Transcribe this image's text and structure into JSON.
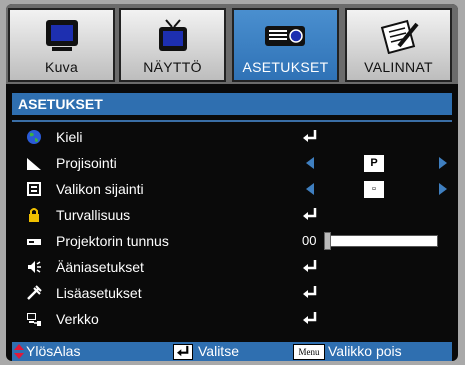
{
  "tabs": [
    {
      "label": "Kuva",
      "icon": "monitor-icon"
    },
    {
      "label": "NÄYTTÖ",
      "icon": "tv-icon"
    },
    {
      "label": "ASETUKSET",
      "icon": "projector-icon",
      "active": true
    },
    {
      "label": "VALINNAT",
      "icon": "notepad-pencil-icon"
    }
  ],
  "section_title": "ASETUKSET",
  "menu": {
    "items": [
      {
        "label": "Kieli",
        "icon": "globe-icon",
        "control": "enter"
      },
      {
        "label": "Projisointi",
        "icon": "projection-icon",
        "control": "selector",
        "value": "P"
      },
      {
        "label": "Valikon sijainti",
        "icon": "menu-location-icon",
        "control": "selector",
        "value": "▫"
      },
      {
        "label": "Turvallisuus",
        "icon": "lock-icon",
        "control": "enter"
      },
      {
        "label": "Projektorin tunnus",
        "icon": "projector-id-icon",
        "control": "slider",
        "value": "00",
        "level": 0
      },
      {
        "label": "Ääniasetukset",
        "icon": "speaker-icon",
        "control": "enter"
      },
      {
        "label": "Lisäasetukset",
        "icon": "advanced-icon",
        "control": "enter"
      },
      {
        "label": "Verkko",
        "icon": "network-icon",
        "control": "enter"
      }
    ]
  },
  "footer": {
    "nav_label": "YlösAlas",
    "select_label": "Valitse",
    "menu_key": "Menu",
    "exit_label": "Valikko pois"
  },
  "colors": {
    "accent": "#2f6fb0",
    "arrow": "#3f7fc0",
    "background": "#0a0a0a"
  }
}
